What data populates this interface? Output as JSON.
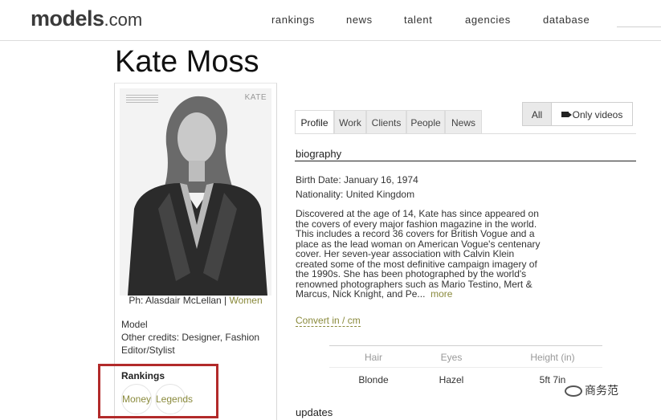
{
  "header": {
    "logo_main": "models",
    "logo_domain": ".com",
    "nav": [
      "rankings",
      "news",
      "talent",
      "agencies",
      "database"
    ]
  },
  "page": {
    "title": "Kate Moss"
  },
  "card": {
    "photo_mark": "KATE",
    "credit_prefix": "Ph: Alasdair McLellan | ",
    "credit_link": "Women",
    "role": "Model",
    "other_credits": "Other credits: Designer, Fashion Editor/Stylist",
    "rankings_title": "Rankings",
    "rankings": [
      "Money",
      "Legends"
    ]
  },
  "tabs": [
    "Profile",
    "Work",
    "Clients",
    "People",
    "News"
  ],
  "filters": {
    "all": "All",
    "videos": "Only videos"
  },
  "biography": {
    "title": "biography",
    "birth_date": "Birth Date: January 16, 1974",
    "nationality": "Nationality: United Kingdom",
    "text": "Discovered at the age of 14, Kate has since appeared on the covers of every major fashion magazine in the world. This includes a record 36 covers for British Vogue and a place as the lead woman on American Vogue's centenary cover. Her seven-year association with Calvin Klein created some of the most definitive campaign imagery of the 1990s. She has been photographed by the world's renowned photographers such as Mario Testino, Mert & Marcus, Nick Knight, and Pe...",
    "more": "more"
  },
  "convert": "Convert in / cm",
  "stats": {
    "headers": [
      "Hair",
      "Eyes",
      "Height (in)"
    ],
    "values": [
      "Blonde",
      "Hazel",
      "5ft 7in"
    ]
  },
  "updates_title": "updates",
  "watermark": "商务范",
  "colors": {
    "accent": "#8a8a3c",
    "highlight": "#b22a2a"
  }
}
